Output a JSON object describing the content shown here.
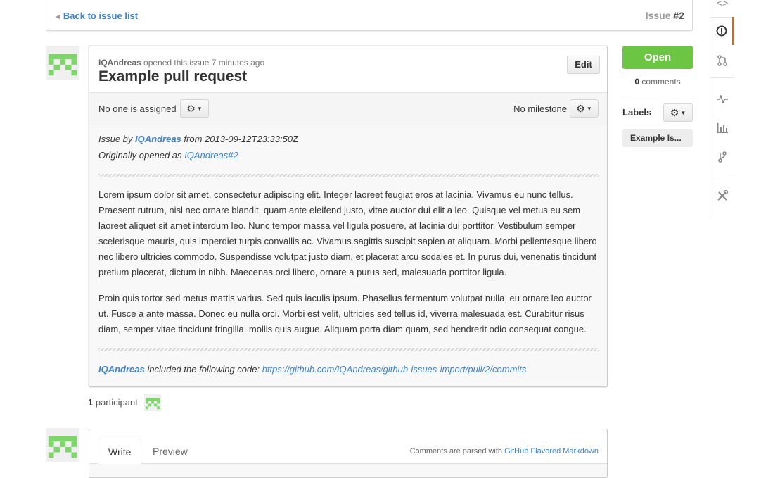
{
  "topbar": {
    "back_label": "Back to issue list",
    "issue_prefix": "Issue ",
    "issue_number": "#2"
  },
  "issue": {
    "author": "IQAndreas",
    "opened_text": "opened this issue 7 minutes ago",
    "title": "Example pull request",
    "edit_label": "Edit",
    "assignee_text": "No one is assigned",
    "milestone_text": "No milestone",
    "body": {
      "issue_by_prefix": "Issue by ",
      "issue_by_user": "IQAndreas",
      "issue_by_suffix": " from 2013-09-12T23:33:50Z",
      "originally_prefix": "Originally opened as ",
      "originally_link": "IQAndreas#2",
      "paragraph1": "Lorem ipsum dolor sit amet, consectetur adipiscing elit. Integer laoreet feugiat eros at lacinia. Vivamus eu nunc tellus. Praesent rutrum, nisl nec ornare blandit, quam ante eleifend justo, vitae auctor dui elit a leo. Quisque vel metus eu sem laoreet aliquet sit amet interdum leo. Nunc tempor massa vel ligula posuere, at lacinia dui porttitor. Vestibulum semper scelerisque mauris, quis imperdiet turpis convallis ac. Vivamus sagittis suscipit sapien at aliquam. Morbi pellentesque libero nec libero ultricies commodo. Suspendisse volutpat justo diam, et placerat arcu sodales et. In purus dui, venenatis tincidunt pretium placerat, dictum in nibh. Maecenas orci libero, ornare a purus sed, malesuada porttitor ligula.",
      "paragraph2": "Proin quis tortor sed metus mattis varius. Sed quis iaculis ipsum. Phasellus fermentum volutpat nulla, eu ornare leo auctor ut. Fusce a ante massa. Donec eu nulla orci. Morbi est velit, ultricies sed tellus id, viverra malesuada est. Curabitur risus diam, semper vitae tincidunt fringilla, mollis quis augue. Aliquam porta diam quam, sed hendrerit odio consequat congue.",
      "code_user": "IQAndreas",
      "code_text": " included the following code: ",
      "code_link": "https://github.com/IQAndreas/github-issues-import/pull/2/commits"
    }
  },
  "participants": {
    "count": "1",
    "label": " participant"
  },
  "comment": {
    "tab_write": "Write",
    "tab_preview": "Preview",
    "note_prefix": "Comments are parsed with ",
    "note_link": "GitHub Flavored Markdown"
  },
  "sidebar": {
    "status": "Open",
    "comments_count": "0",
    "comments_label": " comments",
    "labels_title": "Labels",
    "label_chip": "Example Is..."
  },
  "colors": {
    "open_green": "#6cc644",
    "link_blue": "#4183c4",
    "nav_active": "#d26911",
    "identicon_green": "#7fd56b"
  },
  "icons": [
    "code-icon",
    "issue-icon",
    "pull-request-icon",
    "pulse-icon",
    "graph-icon",
    "network-icon",
    "settings-icon",
    "gear-icon"
  ]
}
